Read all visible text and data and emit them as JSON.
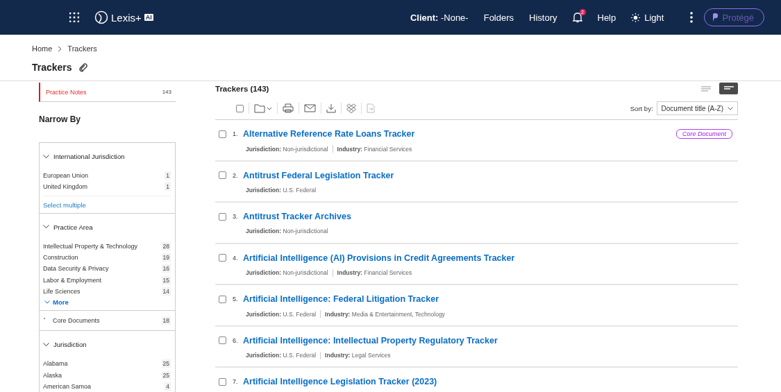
{
  "header": {
    "logo": "Lexis+",
    "logo_badge": "AI",
    "client_label": "Client:",
    "client_value": "-None-",
    "nav": [
      "Folders",
      "History"
    ],
    "notifications": "2",
    "help": "Help",
    "theme": "Light",
    "protege": "Protégé"
  },
  "breadcrumb": [
    "Home",
    "Trackers"
  ],
  "page_title": "Trackers",
  "content_types": [
    {
      "label": "Practice Notes",
      "count": "143",
      "selected": true
    }
  ],
  "narrow_by": "Narrow By",
  "facets": [
    {
      "kind": "group",
      "title": "International Jurisdiction",
      "expanded": true,
      "items": [
        {
          "label": "European Union",
          "count": "1"
        },
        {
          "label": "United Kingdom",
          "count": "1"
        }
      ],
      "link": "Select multiple"
    },
    {
      "kind": "group",
      "title": "Practice Area",
      "expanded": true,
      "items": [
        {
          "label": "Intellectual Property & Technology",
          "count": "28"
        },
        {
          "label": "Construction",
          "count": "19"
        },
        {
          "label": "Data Security & Privacy",
          "count": "16"
        },
        {
          "label": "Labor & Employment",
          "count": "15"
        },
        {
          "label": "Life Sciences",
          "count": "14"
        }
      ],
      "more": "More"
    },
    {
      "kind": "toggle",
      "title": "Core Documents",
      "count": "18",
      "checked": false
    },
    {
      "kind": "group",
      "title": "Jurisdiction",
      "expanded": true,
      "items": [
        {
          "label": "Alabama",
          "count": "25"
        },
        {
          "label": "Alaska",
          "count": "25"
        },
        {
          "label": "American Samoa",
          "count": "4"
        }
      ]
    }
  ],
  "results": {
    "heading": "Trackers (143)",
    "select_all": {
      "checked": false
    },
    "views": [
      {
        "selected": false
      },
      {
        "selected": true
      }
    ],
    "sort_label": "Sort by:",
    "sort_value": "Document title (A-Z)",
    "rows": [
      {
        "number": "1.",
        "title": "Alternative Reference Rate Loans Tracker",
        "checked": false,
        "badge": "Core Document",
        "meta": [
          {
            "label": "Jurisdiction:",
            "value": "Non-jurisdictional"
          },
          {
            "label": "Industry:",
            "value": "Financial Services"
          }
        ]
      },
      {
        "number": "2.",
        "title": "Antitrust Federal Legislation Tracker",
        "checked": false,
        "meta": [
          {
            "label": "Jurisdiction:",
            "value": "U.S. Federal"
          }
        ]
      },
      {
        "number": "3.",
        "title": "Antitrust Tracker Archives",
        "checked": false,
        "meta": [
          {
            "label": "Jurisdiction:",
            "value": "Non-jurisdictional"
          }
        ]
      },
      {
        "number": "4.",
        "title": "Artificial Intelligence (AI) Provisions in Credit Agreements Tracker",
        "checked": false,
        "meta": [
          {
            "label": "Jurisdiction:",
            "value": "Non-jurisdictional"
          },
          {
            "label": "Industry:",
            "value": "Financial Services"
          }
        ]
      },
      {
        "number": "5.",
        "title": "Artificial Intelligence: Federal Litigation Tracker",
        "checked": false,
        "meta": [
          {
            "label": "Jurisdiction:",
            "value": "U.S. Federal"
          },
          {
            "label": "Industry:",
            "value": "Media & Entertainment, Technology"
          }
        ]
      },
      {
        "number": "6.",
        "title": "Artificial Intelligence: Intellectual Property Regulatory Tracker",
        "checked": false,
        "meta": [
          {
            "label": "Jurisdiction:",
            "value": "U.S. Federal"
          },
          {
            "label": "Industry:",
            "value": "Legal Services"
          }
        ]
      },
      {
        "number": "7.",
        "title": "Artificial Intelligence Legislation Tracker (2023)",
        "checked": false,
        "meta": []
      }
    ]
  }
}
